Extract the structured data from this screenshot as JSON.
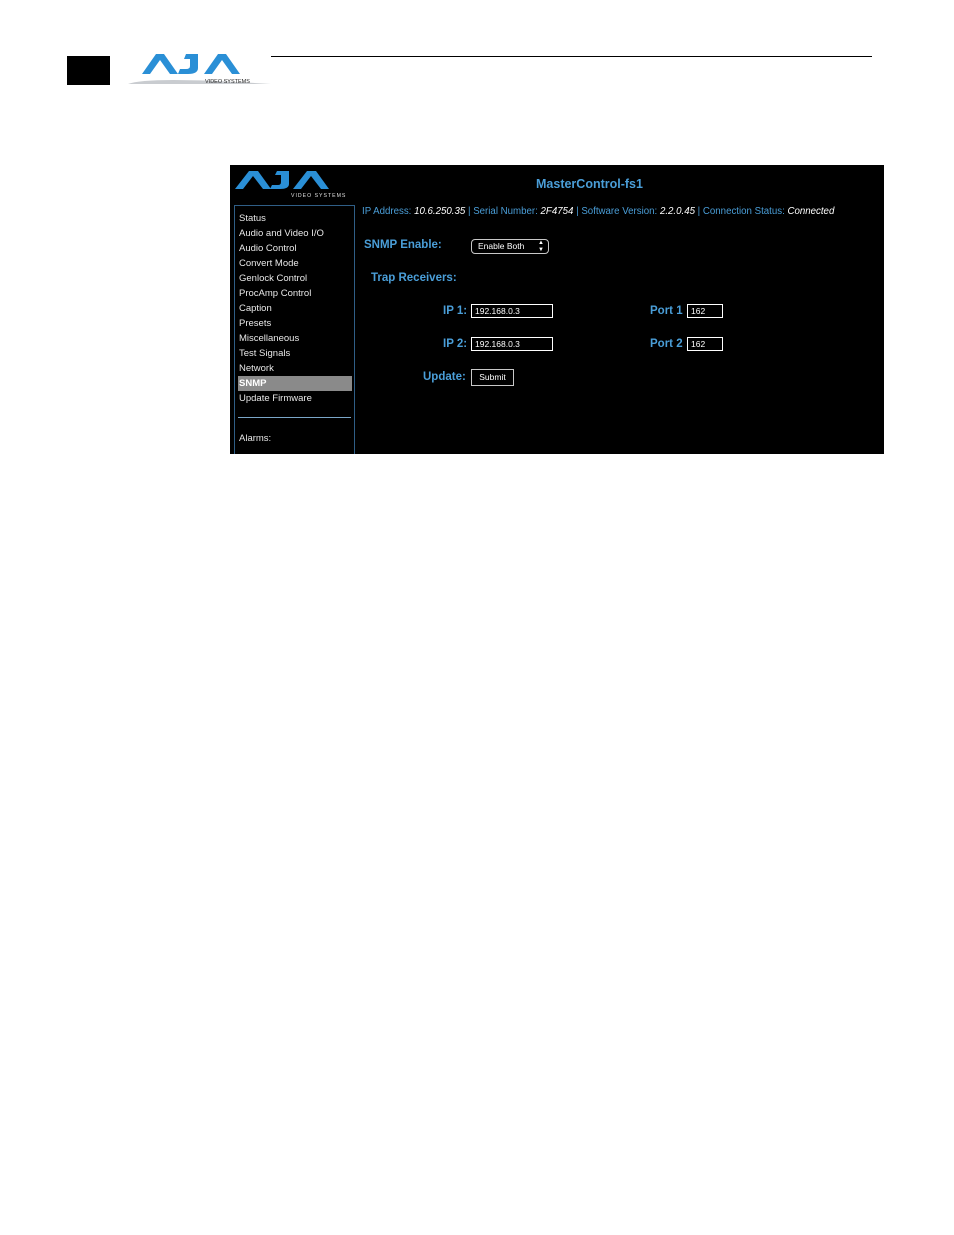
{
  "header": {
    "logo_text": "AJA",
    "logo_subtext": "VIDEO SYSTEMS"
  },
  "app": {
    "logo_text": "AJA",
    "logo_subtext": "VIDEO SYSTEMS",
    "title": "MasterControl-fs1",
    "status": {
      "ip_label": "IP Address:",
      "ip_value": "10.6.250.35",
      "serial_label": "Serial Number:",
      "serial_value": "2F4754",
      "software_label": "Software Version:",
      "software_value": "2.2.0.45",
      "connection_label": "Connection Status:",
      "connection_value": "Connected",
      "separator": "|"
    },
    "sidebar": {
      "items": [
        {
          "label": "Status",
          "active": false
        },
        {
          "label": "Audio and Video I/O",
          "active": false
        },
        {
          "label": "Audio Control",
          "active": false
        },
        {
          "label": "Convert Mode",
          "active": false
        },
        {
          "label": "Genlock Control",
          "active": false
        },
        {
          "label": "ProcAmp Control",
          "active": false
        },
        {
          "label": "Caption",
          "active": false
        },
        {
          "label": "Presets",
          "active": false
        },
        {
          "label": "Miscellaneous",
          "active": false
        },
        {
          "label": "Test Signals",
          "active": false
        },
        {
          "label": "Network",
          "active": false
        },
        {
          "label": "SNMP",
          "active": true
        },
        {
          "label": "Update Firmware",
          "active": false
        }
      ],
      "alarms_label": "Alarms:"
    },
    "form": {
      "snmp_enable_label": "SNMP Enable:",
      "snmp_enable_value": "Enable Both",
      "trap_receivers_label": "Trap Receivers:",
      "ip1_label": "IP 1:",
      "ip1_value": "192.168.0.3",
      "ip2_label": "IP 2:",
      "ip2_value": "192.168.0.3",
      "port1_label": "Port 1",
      "port1_value": "162",
      "port2_label": "Port 2",
      "port2_value": "162",
      "update_label": "Update:",
      "submit_label": "Submit"
    }
  },
  "colors": {
    "accent": "#4a9ed8",
    "logo": "#2a8fd6",
    "background": "#000000"
  }
}
